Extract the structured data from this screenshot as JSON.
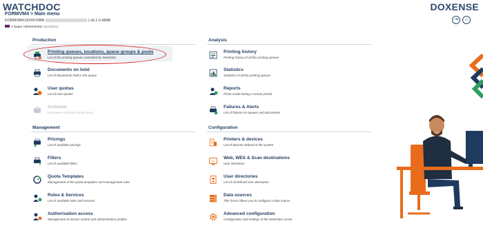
{
  "header": {
    "brand_left": "WATCHDOC",
    "brand_right": "DOXENSE",
    "breadcrumb": "FORMVM4 > Main menu",
    "server_prefix": "FORMVM4.DOXFORM",
    "version": "| v6.1.0.4898",
    "user_role": "Super Administrator",
    "user_extra": "(lysodoro)"
  },
  "colors": {
    "accent_orange": "#e86c1c",
    "navy": "#1f3a5f",
    "green": "#2e9e5e",
    "highlight_ring": "#d42020"
  },
  "production": {
    "title": "Production",
    "items": [
      {
        "title": "Printing queues, locations, queue groups & pools",
        "desc": "List of the printing queues controlled by Watchdoc",
        "icon": "printer-queues-icon"
      },
      {
        "title": "Documents on hold",
        "desc": "List of documents held in the queue",
        "icon": "document-hold-icon"
      },
      {
        "title": "User quotas",
        "desc": "List of user quotas",
        "icon": "user-quota-icon"
      },
      {
        "title": "Archives",
        "desc": "Documents archived by the users",
        "icon": "archive-icon"
      }
    ]
  },
  "analysis": {
    "title": "Analysis",
    "items": [
      {
        "title": "Printing history",
        "desc": "Printing history of all the printing queues",
        "icon": "history-icon"
      },
      {
        "title": "Statistics",
        "desc": "Statistics of all the printing queues",
        "icon": "statistics-icon"
      },
      {
        "title": "Reports",
        "desc": "Prints made during a certain period",
        "icon": "reports-icon"
      },
      {
        "title": "Failures & Alerts",
        "desc": "List of failures on queues and documents",
        "icon": "alerts-icon"
      }
    ]
  },
  "management": {
    "title": "Management",
    "items": [
      {
        "title": "Pricings",
        "desc": "List of available pricings",
        "icon": "pricing-icon"
      },
      {
        "title": "Filters",
        "desc": "List of available filters",
        "icon": "filter-icon"
      },
      {
        "title": "Quota Templates",
        "desc": "Management of the quota templates and management rules",
        "icon": "quota-template-icon"
      },
      {
        "title": "Roles & Services",
        "desc": "List of available roles and services",
        "icon": "roles-icon"
      },
      {
        "title": "Authorisation access",
        "desc": "Management of access control and administration profiles",
        "icon": "authorisation-icon"
      }
    ]
  },
  "configuration": {
    "title": "Configuration",
    "items": [
      {
        "title": "Printers & devices",
        "desc": "List of devices defined in the system",
        "icon": "printer-devices-icon"
      },
      {
        "title": "Web, WES & Scan destinations",
        "desc": "User interfaces",
        "icon": "web-wes-icon"
      },
      {
        "title": "User directories",
        "desc": "List of all defined user directories",
        "icon": "user-directories-icon"
      },
      {
        "title": "Data sources",
        "desc": "This forms allows you to configure a data source",
        "icon": "data-sources-icon"
      },
      {
        "title": "Advanced configuration",
        "desc": "Configuration and settings of the Watchdoc server",
        "icon": "advanced-config-icon"
      }
    ]
  }
}
